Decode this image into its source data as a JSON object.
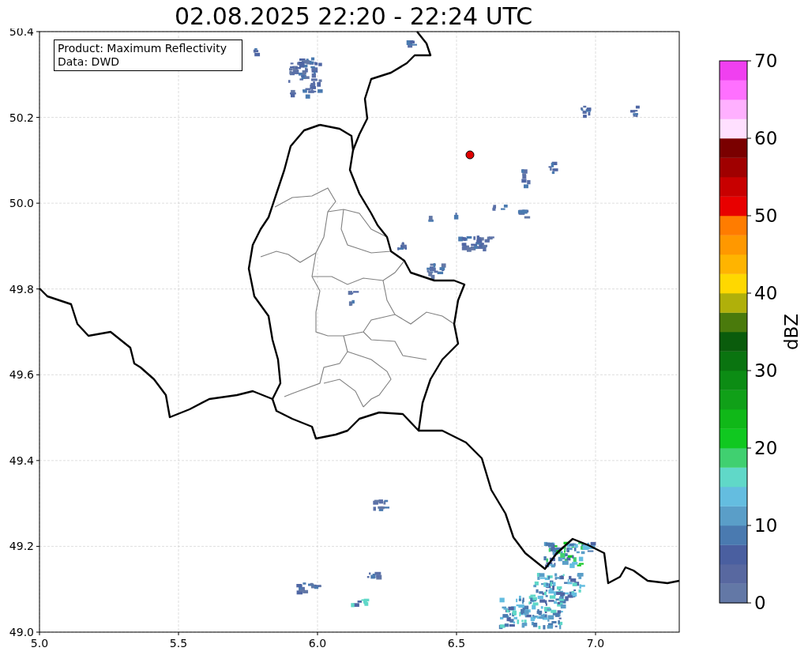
{
  "title": "02.08.2025 22:20 - 22:24 UTC",
  "info_box": {
    "lines": [
      "Product: Maximum Reflectivity",
      "Data: DWD"
    ]
  },
  "map": {
    "xticks": [
      "5.0",
      "5.5",
      "6.0",
      "6.5",
      "7.0"
    ],
    "yticks": [
      "50.4",
      "50.2",
      "50.0",
      "49.8",
      "49.6",
      "49.4",
      "49.2",
      "49.0"
    ]
  },
  "colorbar": {
    "label": "dBZ",
    "ticks": [
      "70",
      "60",
      "50",
      "40",
      "30",
      "20",
      "10",
      "0"
    ],
    "bands": [
      {
        "color": "#6378a6"
      },
      {
        "color": "#5868a0"
      },
      {
        "color": "#4a5fa0"
      },
      {
        "color": "#4a7ab0"
      },
      {
        "color": "#5a9ec8"
      },
      {
        "color": "#64bde0"
      },
      {
        "color": "#60d8c8"
      },
      {
        "color": "#40d070"
      },
      {
        "color": "#10c820"
      },
      {
        "color": "#10b818"
      },
      {
        "color": "#10a018"
      },
      {
        "color": "#0c8c14"
      },
      {
        "color": "#0a7410"
      },
      {
        "color": "#0a5c0c"
      },
      {
        "color": "#4a7a0c"
      },
      {
        "color": "#b0b00a"
      },
      {
        "color": "#ffd800"
      },
      {
        "color": "#ffb400"
      },
      {
        "color": "#ff9800"
      },
      {
        "color": "#ff7c00"
      },
      {
        "color": "#e80000"
      },
      {
        "color": "#c80000"
      },
      {
        "color": "#a00000"
      },
      {
        "color": "#7a0000"
      },
      {
        "color": "#ffe0ff"
      },
      {
        "color": "#ffb0ff"
      },
      {
        "color": "#ff70ff"
      },
      {
        "color": "#f040f0"
      }
    ]
  }
}
